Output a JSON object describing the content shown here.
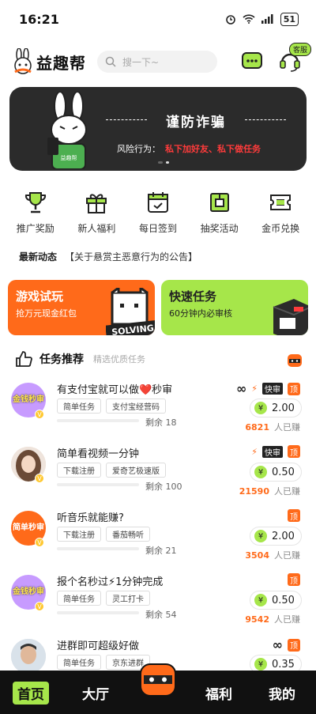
{
  "status_bar": {
    "time": "16:21",
    "battery": "51"
  },
  "header": {
    "logo_text": "益趣帮",
    "search_placeholder": "搜一下~",
    "cs_badge": "客服"
  },
  "banner": {
    "title": "谨防诈骗",
    "risk_label": "风险行为：",
    "risk_text": "私下加好友、私下做任务",
    "shirt_text": "益趣帮"
  },
  "actions": [
    {
      "label": "推广奖励",
      "icon": "trophy-icon"
    },
    {
      "label": "新人福利",
      "icon": "gift-icon"
    },
    {
      "label": "每日签到",
      "icon": "calendar-icon"
    },
    {
      "label": "抽奖活动",
      "icon": "prize-box-icon"
    },
    {
      "label": "金币兑换",
      "icon": "ticket-icon"
    }
  ],
  "news": {
    "tag": "最新动态",
    "text": "【关于悬赏主恶意行为的公告】"
  },
  "promos": {
    "game": {
      "title": "游戏试玩",
      "sub": "抢万元现金红包",
      "art_text": "SOLVING"
    },
    "fast": {
      "title": "快速任务",
      "sub": "60分钟内必审核"
    }
  },
  "section": {
    "title": "任务推荐",
    "sub": "精选优质任务"
  },
  "tasks": [
    {
      "title": "有支付宝就可以做❤️秒审",
      "avatar_text": "金钱秒审",
      "tags": [
        "简单任务",
        "支付宝经营码"
      ],
      "remain_label": "剩余",
      "remain": "18",
      "infinite": true,
      "fast": true,
      "price": "2.00",
      "earned": "6821",
      "earned_label": "人已赚"
    },
    {
      "title": "简单看视频一分钟",
      "avatar_text": "",
      "tags": [
        "下载注册",
        "爱奇艺极速版"
      ],
      "remain_label": "剩余",
      "remain": "100",
      "infinite": false,
      "fast": true,
      "price": "0.50",
      "earned": "21590",
      "earned_label": "人已赚"
    },
    {
      "title": "听音乐就能赚?",
      "avatar_text": "简单秒审",
      "tags": [
        "下载注册",
        "番茄畅听"
      ],
      "remain_label": "剩余",
      "remain": "21",
      "infinite": false,
      "fast": false,
      "price": "2.00",
      "earned": "3504",
      "earned_label": "人已赚"
    },
    {
      "title": "报个名秒过⚡1分钟完成",
      "avatar_text": "金钱秒审",
      "tags": [
        "简单任务",
        "灵工打卡"
      ],
      "remain_label": "剩余",
      "remain": "54",
      "infinite": false,
      "fast": false,
      "price": "0.50",
      "earned": "9542",
      "earned_label": "人已赚"
    },
    {
      "title": "进群即可超级好做",
      "avatar_text": "",
      "tags": [
        "简单任务",
        "京东进群"
      ],
      "remain_label": "",
      "remain": "",
      "infinite": true,
      "fast": false,
      "price": "0.35",
      "earned": "",
      "earned_label": ""
    }
  ],
  "labels": {
    "fast": "快审",
    "top": "顶",
    "yen": "¥",
    "infinity": "∞"
  },
  "bottom_nav": {
    "home": "首页",
    "hall": "大厅",
    "welfare": "福利",
    "mine": "我的"
  },
  "colors": {
    "accent_green": "#a6e64a",
    "accent_orange": "#ff6a1a",
    "dark": "#2b2b2b"
  }
}
